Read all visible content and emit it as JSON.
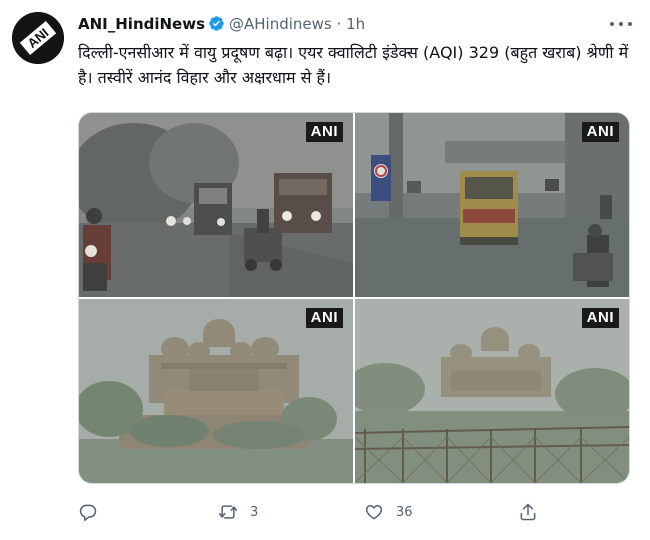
{
  "author": {
    "display_name": "ANI_HindiNews",
    "handle": "@AHindinews",
    "separator": "·",
    "time": "1h",
    "avatar_text": "ANI"
  },
  "tweet": {
    "text": "दिल्ली-एनसीआर में वायु प्रदूषण बढ़ा। एयर क्वालिटी इंडेक्स (AQI) 329 (बहुत खराब) श्रेणी में है। तस्वीरें आनंद विहार और अक्षरधाम से हैं।"
  },
  "media": {
    "watermark": "ANI",
    "photos": [
      {
        "id": "smog-road-night"
      },
      {
        "id": "smog-street-bus"
      },
      {
        "id": "akshardham-smog-1"
      },
      {
        "id": "akshardham-smog-2"
      }
    ]
  },
  "actions": {
    "reply_count": "",
    "retweet_count": "3",
    "like_count": "36"
  },
  "colors": {
    "verified": "#1d9bf0",
    "secondary_text": "#536471",
    "border": "#cfd9de"
  }
}
